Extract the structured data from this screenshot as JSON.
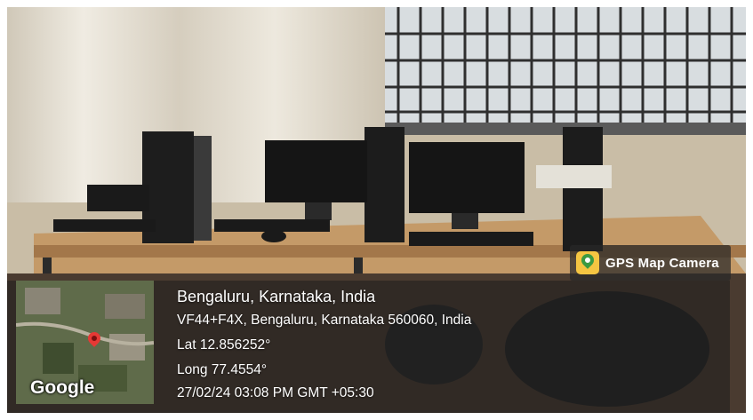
{
  "overlay": {
    "badge_label": "GPS Map Camera",
    "address_line": "Bengaluru, Karnataka, India",
    "plus_code_line": "VF44+F4X, Bengaluru, Karnataka 560060, India",
    "latitude_line": "Lat 12.856252°",
    "longitude_line": "Long 77.4554°",
    "datetime_line": "27/02/24 03:08 PM GMT +05:30",
    "map_brand": "Google"
  },
  "icons": {
    "badge": "map-pin-app-icon",
    "map_marker": "location-pin-icon"
  },
  "colors": {
    "pin_red": "#e53935",
    "badge_yellow": "#f5c542",
    "badge_green": "#3c9a42"
  }
}
